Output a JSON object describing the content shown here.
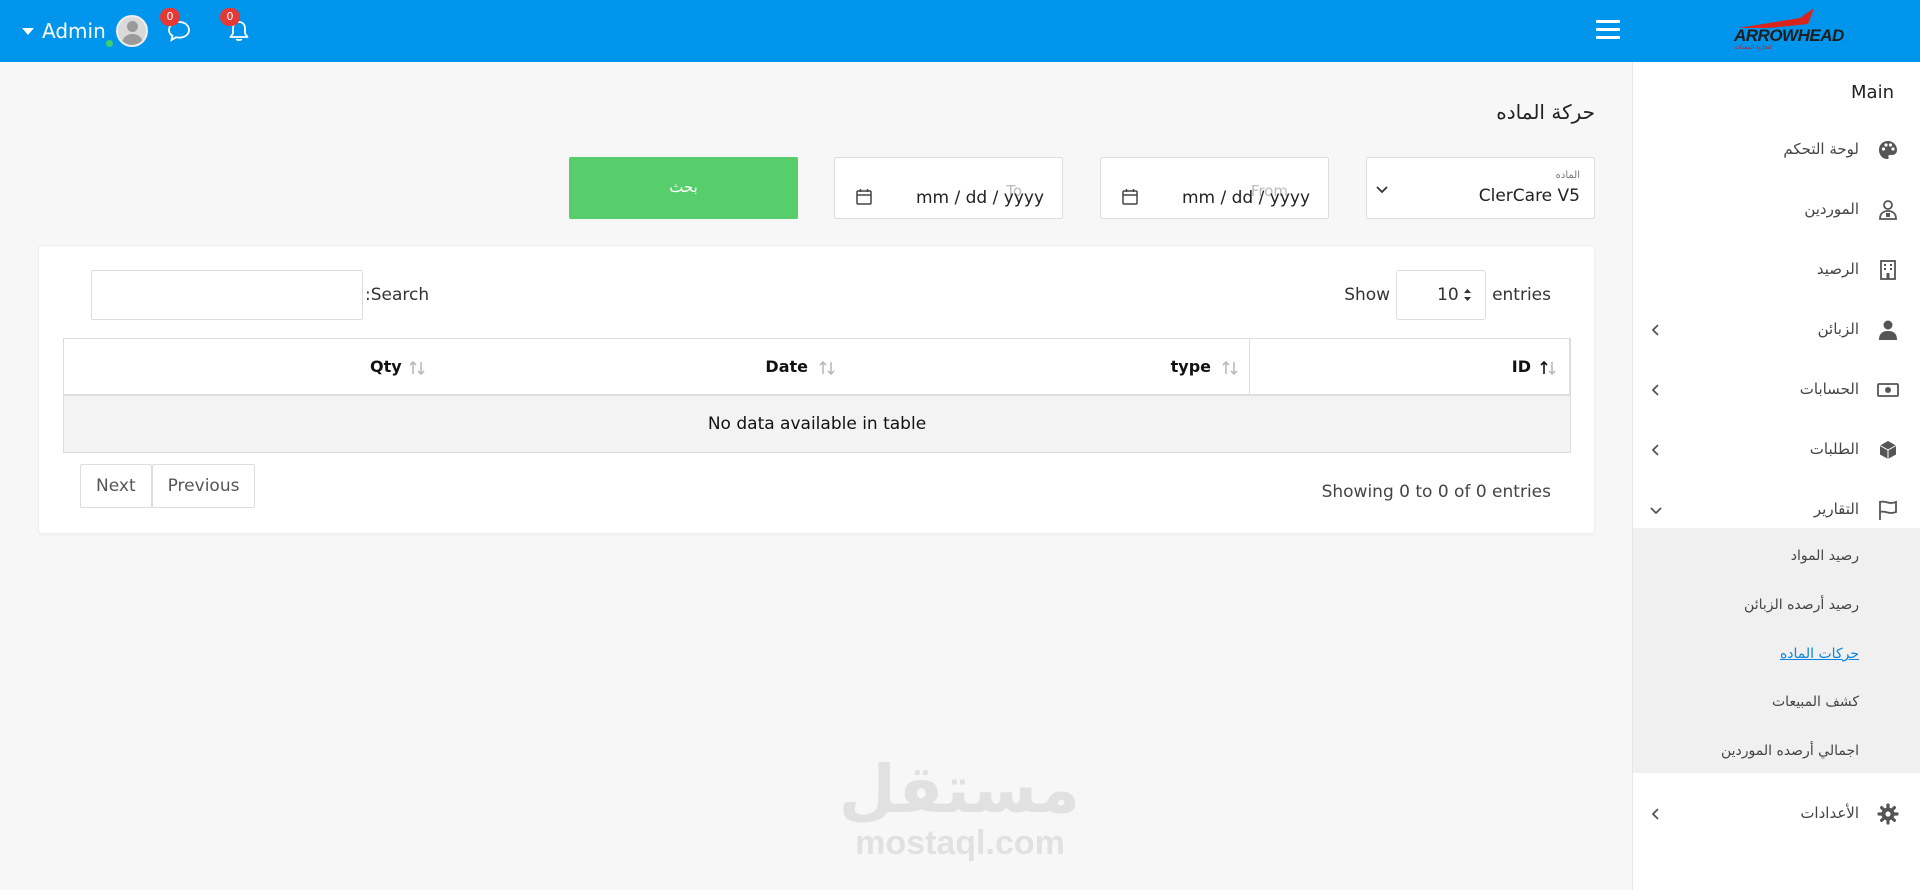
{
  "topbar": {
    "user_name": "Admin",
    "messages_count": "0",
    "notifications_count": "0",
    "logo_text": "ARROWHEAD",
    "logo_sub": "لتجارة المعدات",
    "accent_color": "#0095ec"
  },
  "sidebar": {
    "title": "Main",
    "items": [
      {
        "label": "لوحة التحكم",
        "icon": "palette-icon"
      },
      {
        "label": "الموردين",
        "icon": "supplier-icon"
      },
      {
        "label": "الرصيد",
        "icon": "building-icon"
      },
      {
        "label": "الزبائن",
        "icon": "user-icon"
      },
      {
        "label": "الحسابات",
        "icon": "money-icon"
      },
      {
        "label": "الطلبات",
        "icon": "cube-icon"
      },
      {
        "label": "التقارير",
        "icon": "flag-icon"
      },
      {
        "label": "الأعدادات",
        "icon": "gear-icon"
      }
    ],
    "reports_submenu": [
      {
        "label": "رصيد المواد"
      },
      {
        "label": "رصيد أرصده الزبائن"
      },
      {
        "label": "حركات الماده"
      },
      {
        "label": "كشف المبيعات"
      },
      {
        "label": "اجمالي أرصده الموردين"
      }
    ]
  },
  "main": {
    "title": "حركة الماده",
    "material_label": "الماده",
    "material_value": "ClerCare V5",
    "from_placeholder": "From",
    "from_value": "mm / dd / yyyy",
    "to_placeholder": "To",
    "to_value": "mm / dd / yyyy",
    "search_button": "بحث",
    "search_color": "#57cd6b"
  },
  "table": {
    "show_label": "Show",
    "entries_value": "10",
    "entries_label": "entries",
    "search_label": ":Search",
    "columns": [
      "ID",
      "type",
      "Date",
      "Qty"
    ],
    "empty_message": "No data available in table",
    "info": "Showing 0 to 0 of 0 entries",
    "previous": "Previous",
    "next": "Next"
  },
  "watermark": {
    "arabic": "مستقل",
    "latin": "mostaql.com"
  }
}
